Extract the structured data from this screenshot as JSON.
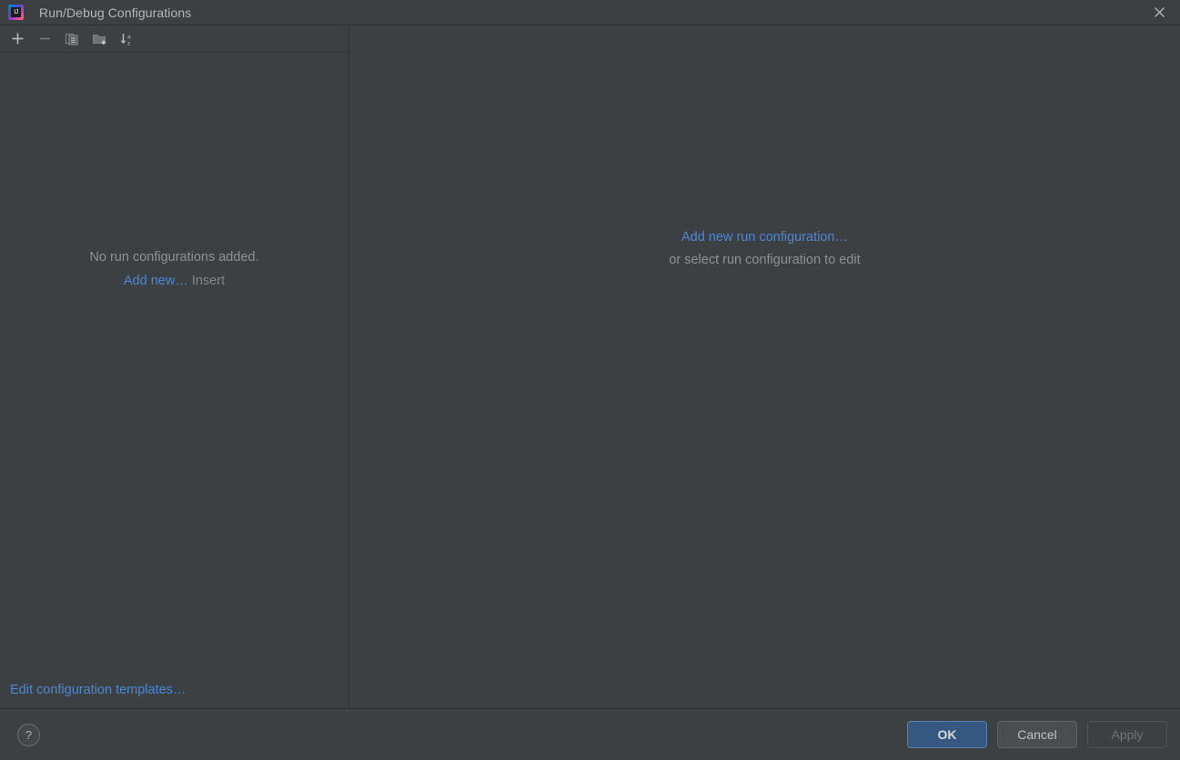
{
  "window": {
    "title": "Run/Debug Configurations",
    "app_icon": "intellij-idea-logo",
    "app_icon_text": "IJ",
    "close_icon": "close-icon"
  },
  "toolbar": {
    "buttons": [
      {
        "name": "add-configuration",
        "icon": "plus-icon"
      },
      {
        "name": "remove-configuration",
        "icon": "minus-icon"
      },
      {
        "name": "copy-configuration",
        "icon": "copy-icon"
      },
      {
        "name": "new-folder",
        "icon": "new-folder-icon"
      },
      {
        "name": "sort-configurations",
        "icon": "sort-alphabetical-icon"
      }
    ]
  },
  "left_panel": {
    "empty_message": "No run configurations added.",
    "add_new_link": "Add new…",
    "shortcut_hint": "Insert",
    "edit_templates_link": "Edit configuration templates…"
  },
  "right_panel": {
    "add_link": "Add new run configuration…",
    "subtitle": "or select run configuration to edit"
  },
  "footer": {
    "help_label": "?",
    "ok_label": "OK",
    "cancel_label": "Cancel",
    "apply_label": "Apply"
  },
  "colors": {
    "background": "#3c4043",
    "link": "#4a88d8",
    "default_button": "#365880",
    "muted_text": "#8d9194"
  }
}
